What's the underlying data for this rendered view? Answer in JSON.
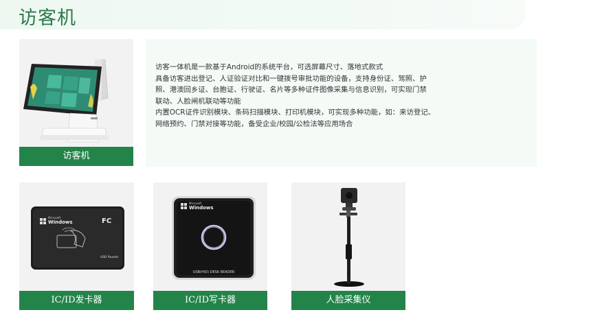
{
  "header": {
    "title": "访客机"
  },
  "visitor_machine": {
    "label": "访客机"
  },
  "description": {
    "lines": [
      "访客一体机是一款基于Android的系统平台，可选屏幕尺寸、落地式款式",
      "具备访客进出登记、人证验证对比和一键拨号审批功能的设备，支持身份证、驾照、护",
      "照、港澳回乡证、台胞证、行驶证、名片等多种证件图像采集与信息识别，可实现门禁",
      "联动、人脸闸机联动等功能",
      "内置OCR证件识别模块、条码扫描模块、打印机模块，可实现多种功能，如：来访登记、",
      "网络预约、门禁对接等功能，备受企业/校园/公检法等应用场合"
    ]
  },
  "products": [
    {
      "label": "IC/ID发卡器",
      "device_brand": "Microsoft",
      "device_name": "Windows",
      "fc_mark": "FC",
      "usb_text": "USB Reader"
    },
    {
      "label": "IC/ID写卡器",
      "device_brand": "Microsoft",
      "device_name": "Windows",
      "usb_text": "USB(HID) DESK READER"
    },
    {
      "label": "人脸采集仪"
    }
  ],
  "colors": {
    "accent": "#23844a",
    "title": "#2d7a4b",
    "panel": "#f4fbf7"
  }
}
